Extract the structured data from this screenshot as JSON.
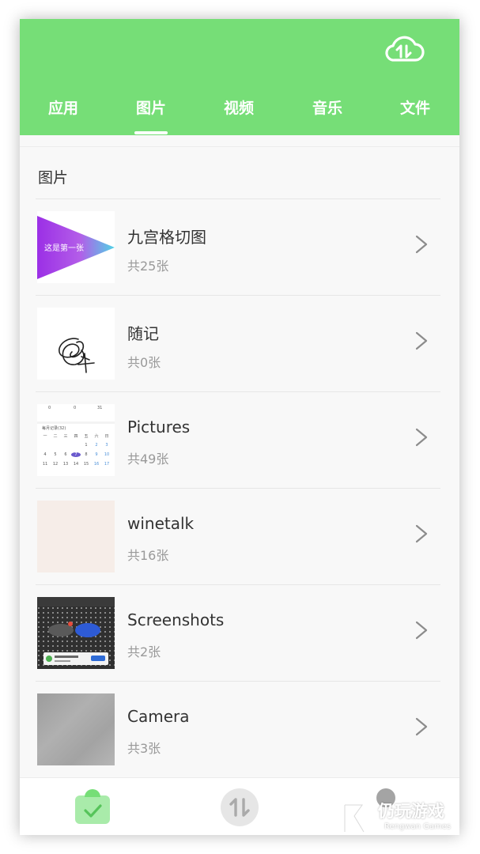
{
  "colors": {
    "accent": "#76de77",
    "background": "#f8f8f8",
    "text_primary": "#333333",
    "text_secondary": "#999999"
  },
  "header": {
    "cloud_icon": "cloud-transfer-icon",
    "tabs": [
      {
        "label": "应用",
        "active": false
      },
      {
        "label": "图片",
        "active": true
      },
      {
        "label": "视频",
        "active": false
      },
      {
        "label": "音乐",
        "active": false
      },
      {
        "label": "文件",
        "active": false
      }
    ]
  },
  "section": {
    "title": "图片"
  },
  "albums": [
    {
      "name": "九宫格切图",
      "count": "共25张",
      "thumb_text": "这是第一张",
      "thumb": "gradient-triangle"
    },
    {
      "name": "随记",
      "count": "共0张",
      "thumb": "handwriting-sketch"
    },
    {
      "name": "Pictures",
      "count": "共49张",
      "thumb": "calendar-screenshot",
      "thumb_texts": {
        "stats": [
          "0",
          "0",
          "31"
        ],
        "header": "每月记录(32)",
        "weekdays": [
          "一",
          "二",
          "三",
          "四",
          "五",
          "六",
          "日"
        ],
        "row1": [
          "",
          "",
          "",
          "",
          "1",
          "2",
          "3"
        ],
        "row2": [
          "4",
          "5",
          "6",
          "7",
          "8",
          "9",
          "10"
        ],
        "row3": [
          "11",
          "12",
          "13",
          "14",
          "15",
          "16",
          "17"
        ]
      }
    },
    {
      "name": "winetalk",
      "count": "共16张",
      "thumb": "blank-beige"
    },
    {
      "name": "Screenshots",
      "count": "共2张",
      "thumb": "dark-screenshot"
    },
    {
      "name": "Camera",
      "count": "共3张",
      "thumb": "gray-photo"
    }
  ],
  "bottom_nav": [
    {
      "name": "clipboard-check-icon",
      "active": true
    },
    {
      "name": "transfer-icon",
      "active": false
    },
    {
      "name": "profile-icon",
      "active": false
    }
  ],
  "watermark": {
    "title": "仍玩游戏",
    "subtitle": "Rengwan Games"
  }
}
